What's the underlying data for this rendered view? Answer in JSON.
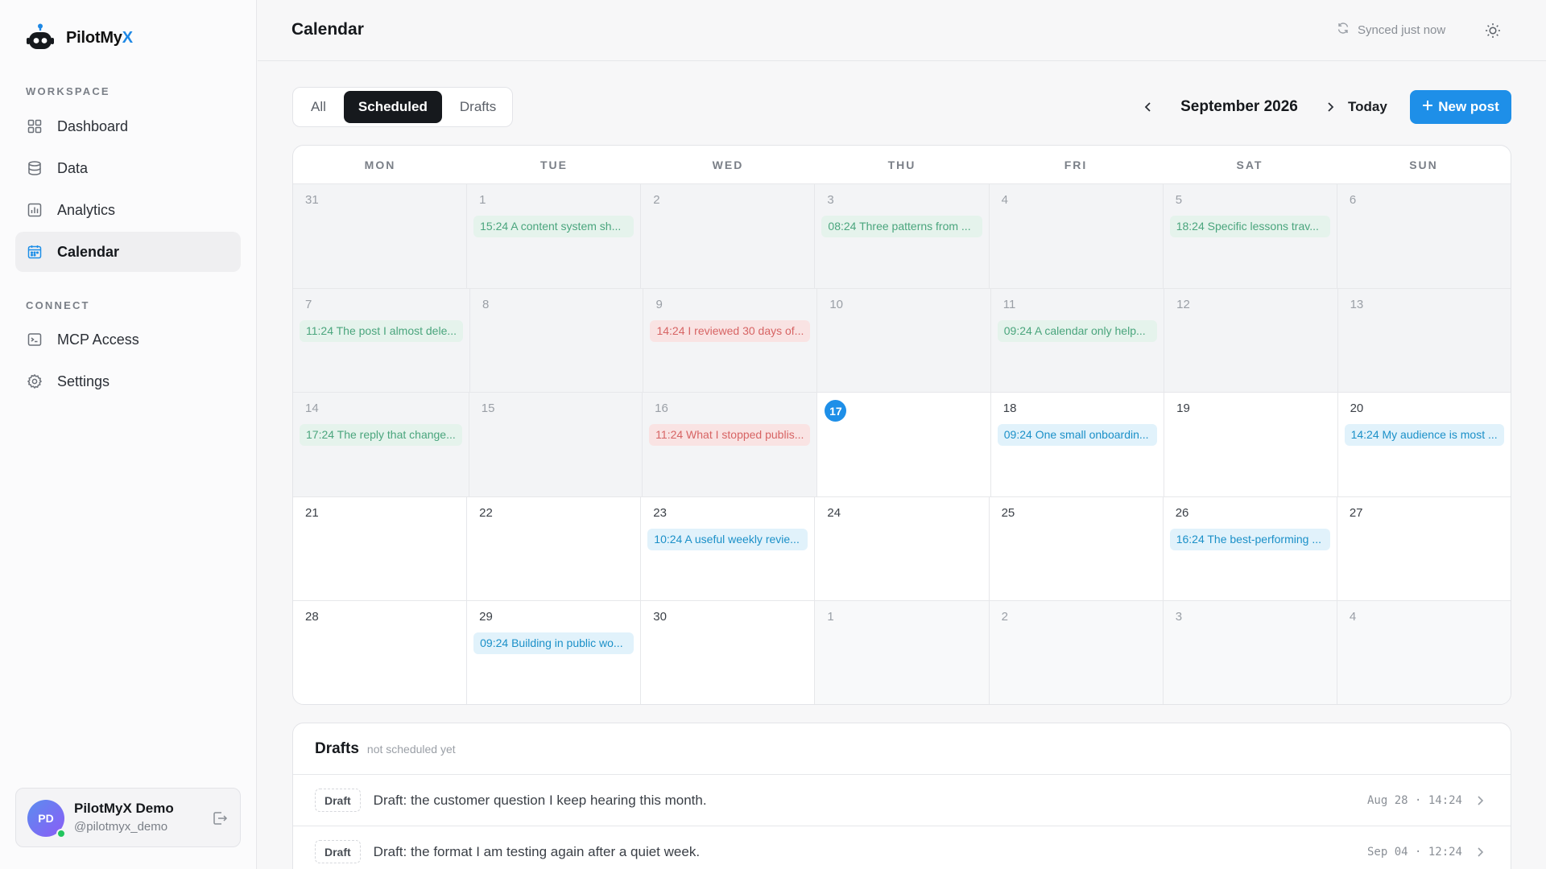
{
  "brand": {
    "name_main": "PilotMy",
    "name_accent": "X"
  },
  "sidebar": {
    "workspace_label": "WORKSPACE",
    "workspace_items": [
      {
        "label": "Dashboard",
        "icon": "grid-icon"
      },
      {
        "label": "Data",
        "icon": "database-icon"
      },
      {
        "label": "Analytics",
        "icon": "bar-chart-icon"
      },
      {
        "label": "Calendar",
        "icon": "calendar-icon",
        "active": true
      }
    ],
    "connect_label": "CONNECT",
    "connect_items": [
      {
        "label": "MCP Access",
        "icon": "terminal-icon"
      },
      {
        "label": "Settings",
        "icon": "gear-icon"
      }
    ]
  },
  "user": {
    "initials": "PD",
    "name": "PilotMyX Demo",
    "handle": "@pilotmyx_demo"
  },
  "header": {
    "title": "Calendar",
    "sync_status": "Synced just now"
  },
  "toolbar": {
    "filters": [
      "All",
      "Scheduled",
      "Drafts"
    ],
    "active_filter": "Scheduled",
    "month": "September 2026",
    "today_label": "Today",
    "new_post_label": "New post"
  },
  "calendar": {
    "weekdays": [
      "MON",
      "TUE",
      "WED",
      "THU",
      "FRI",
      "SAT",
      "SUN"
    ],
    "weeks": [
      [
        {
          "day": "31",
          "kind": "past"
        },
        {
          "day": "1",
          "kind": "past",
          "event": {
            "text": "15:24 A content system sh...",
            "status": "published"
          }
        },
        {
          "day": "2",
          "kind": "past"
        },
        {
          "day": "3",
          "kind": "past",
          "event": {
            "text": "08:24 Three patterns from ...",
            "status": "published"
          }
        },
        {
          "day": "4",
          "kind": "past"
        },
        {
          "day": "5",
          "kind": "past",
          "event": {
            "text": "18:24 Specific lessons trav...",
            "status": "published"
          }
        },
        {
          "day": "6",
          "kind": "past"
        }
      ],
      [
        {
          "day": "7",
          "kind": "past",
          "event": {
            "text": "11:24 The post I almost dele...",
            "status": "published"
          }
        },
        {
          "day": "8",
          "kind": "past"
        },
        {
          "day": "9",
          "kind": "past",
          "event": {
            "text": "14:24 I reviewed 30 days of...",
            "status": "failed"
          }
        },
        {
          "day": "10",
          "kind": "past"
        },
        {
          "day": "11",
          "kind": "past",
          "event": {
            "text": "09:24 A calendar only help...",
            "status": "published"
          }
        },
        {
          "day": "12",
          "kind": "past"
        },
        {
          "day": "13",
          "kind": "past"
        }
      ],
      [
        {
          "day": "14",
          "kind": "past",
          "event": {
            "text": "17:24 The reply that change...",
            "status": "published"
          }
        },
        {
          "day": "15",
          "kind": "past"
        },
        {
          "day": "16",
          "kind": "past",
          "event": {
            "text": "11:24 What I stopped publis...",
            "status": "failed"
          }
        },
        {
          "day": "17",
          "kind": "today"
        },
        {
          "day": "18",
          "kind": "current",
          "event": {
            "text": "09:24 One small onboardin...",
            "status": "scheduled"
          }
        },
        {
          "day": "19",
          "kind": "current"
        },
        {
          "day": "20",
          "kind": "current",
          "event": {
            "text": "14:24 My audience is most ...",
            "status": "scheduled"
          }
        }
      ],
      [
        {
          "day": "21",
          "kind": "current"
        },
        {
          "day": "22",
          "kind": "current"
        },
        {
          "day": "23",
          "kind": "current",
          "event": {
            "text": "10:24 A useful weekly revie...",
            "status": "scheduled"
          }
        },
        {
          "day": "24",
          "kind": "current"
        },
        {
          "day": "25",
          "kind": "current"
        },
        {
          "day": "26",
          "kind": "current",
          "event": {
            "text": "16:24 The best-performing ...",
            "status": "scheduled"
          }
        },
        {
          "day": "27",
          "kind": "current"
        }
      ],
      [
        {
          "day": "28",
          "kind": "current"
        },
        {
          "day": "29",
          "kind": "current",
          "event": {
            "text": "09:24 Building in public wo...",
            "status": "scheduled"
          }
        },
        {
          "day": "30",
          "kind": "current"
        },
        {
          "day": "1",
          "kind": "other"
        },
        {
          "day": "2",
          "kind": "other"
        },
        {
          "day": "3",
          "kind": "other"
        },
        {
          "day": "4",
          "kind": "other"
        }
      ]
    ]
  },
  "drafts": {
    "title": "Drafts",
    "subtitle": "not scheduled yet",
    "items": [
      {
        "badge": "Draft",
        "text": "Draft: the customer question I keep hearing this month.",
        "time": "Aug 28 · 14:24"
      },
      {
        "badge": "Draft",
        "text": "Draft: the format I am testing again after a quiet week.",
        "time": "Sep 04 · 12:24"
      }
    ]
  },
  "colors": {
    "accent": "#1e8fe8",
    "published_bg": "#e5f3ec",
    "published_text": "#4aa57d",
    "failed_bg": "#f9e3e3",
    "failed_text": "#d76464",
    "scheduled_bg": "#e1f2fb",
    "scheduled_text": "#1b90c8"
  }
}
